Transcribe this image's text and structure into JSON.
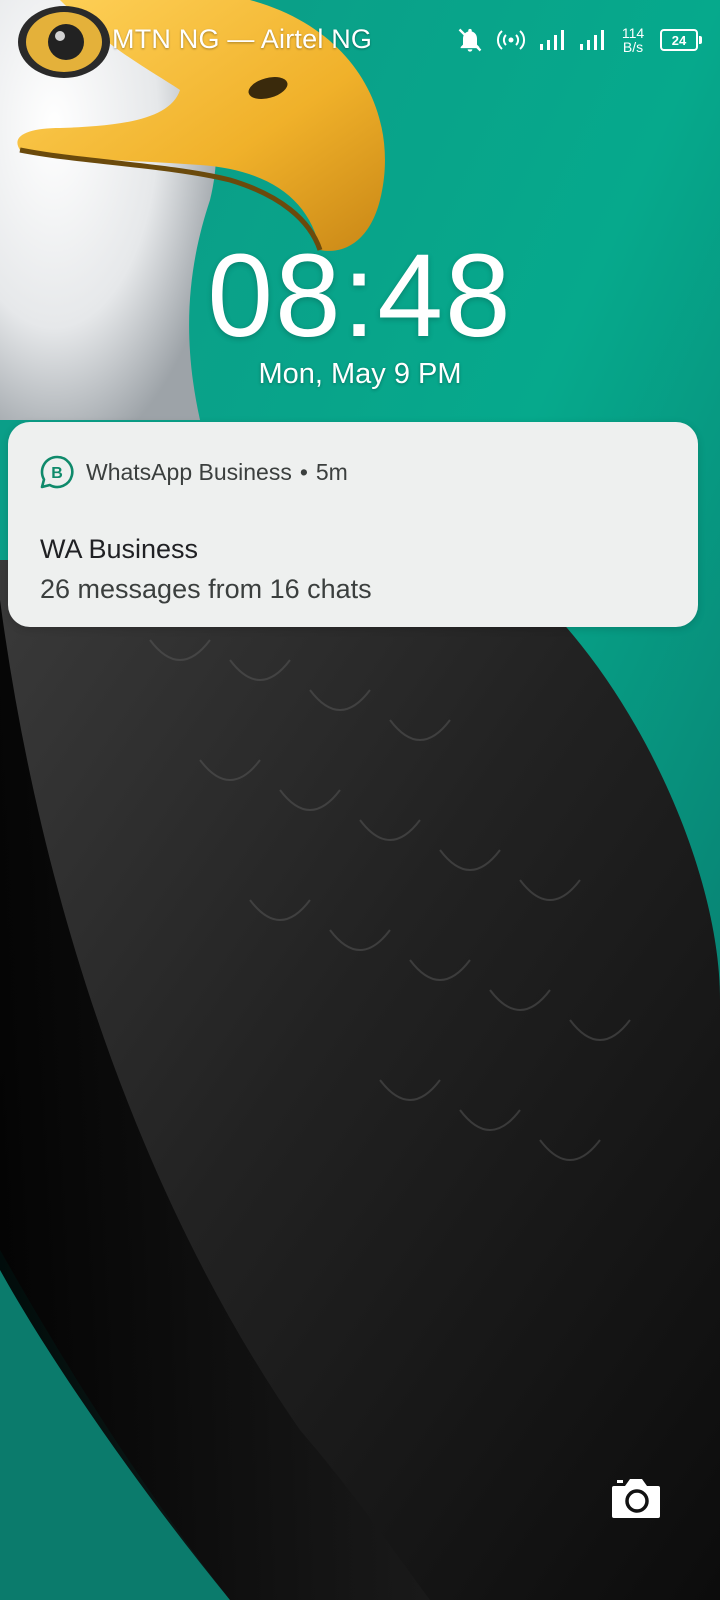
{
  "status_bar": {
    "carrier": "MTN NG — Airtel NG",
    "net_speed_value": "114",
    "net_speed_unit": "B/s",
    "battery": "24",
    "icons": [
      "bell-off-icon",
      "hotspot-icon",
      "signal-icon",
      "signal-icon",
      "battery-icon"
    ]
  },
  "lockscreen": {
    "time": "08:48",
    "date": "Mon, May 9  PM"
  },
  "notification": {
    "app_name": "WhatsApp Business",
    "separator": "•",
    "time_ago": "5m",
    "title": "WA Business",
    "body": "26 messages from 16 chats",
    "icon": "whatsapp-business-icon",
    "accent": "#0f8a6b"
  },
  "shortcut": {
    "icon": "camera-icon"
  },
  "colors": {
    "teal": "#0aa88a",
    "beak": "#f0b12a",
    "notification_bg": "#eef0ef"
  }
}
